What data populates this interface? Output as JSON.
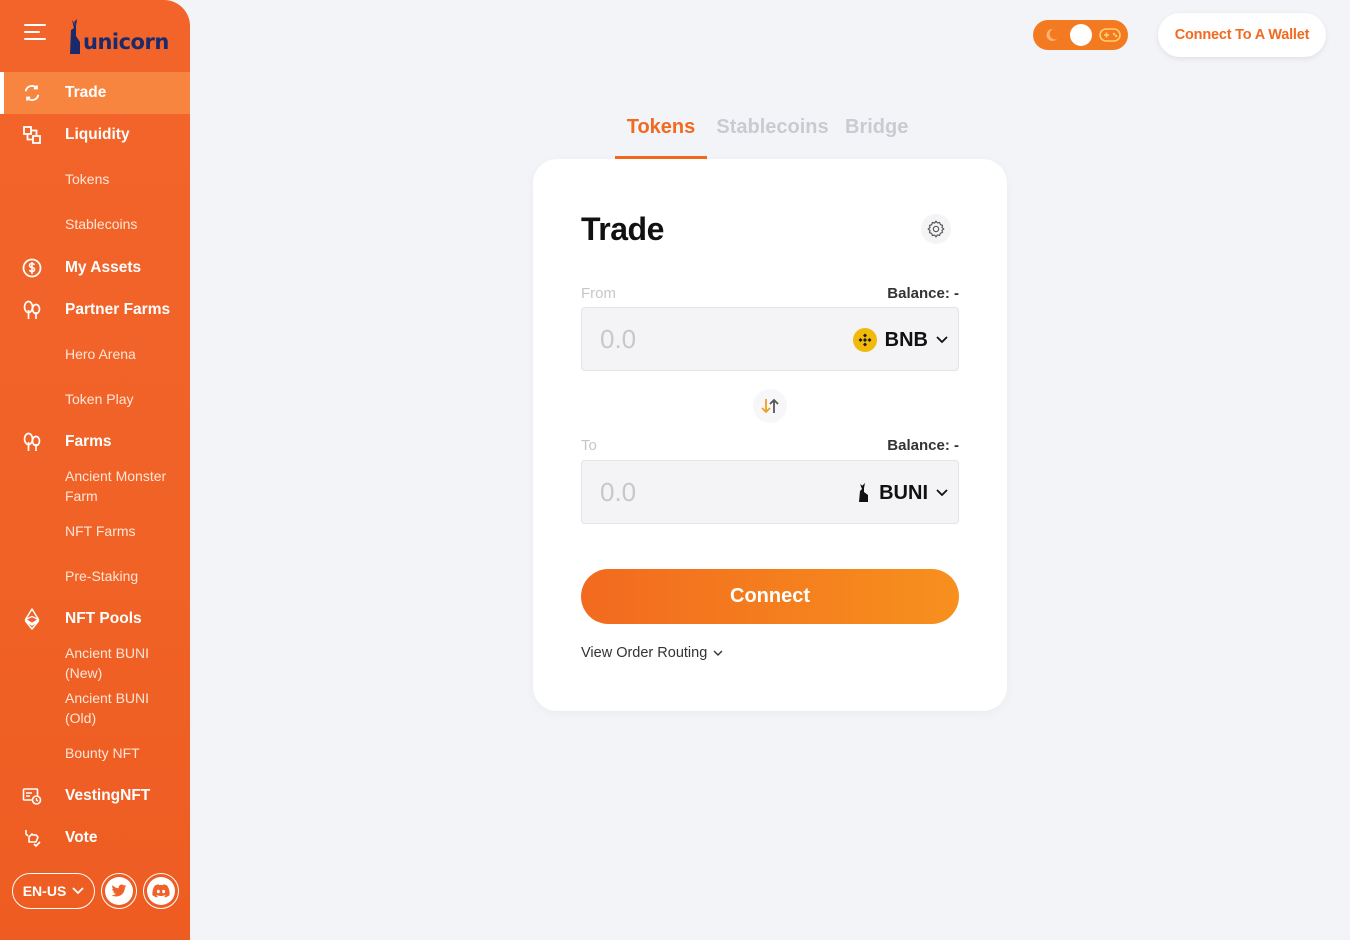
{
  "brand": {
    "name": "unicorn"
  },
  "sidebar": {
    "items": [
      {
        "label": "Trade",
        "type": "main",
        "icon": "swap-refresh-icon",
        "active": true
      },
      {
        "label": "Liquidity",
        "type": "main",
        "icon": "liquidity-icon"
      },
      {
        "label": "Tokens",
        "type": "sub"
      },
      {
        "label": "Stablecoins",
        "type": "sub"
      },
      {
        "label": "My Assets",
        "type": "main",
        "icon": "dollar-icon"
      },
      {
        "label": "Partner Farms",
        "type": "main",
        "icon": "trees-icon"
      },
      {
        "label": "Hero Arena",
        "type": "sub"
      },
      {
        "label": "Token Play",
        "type": "sub"
      },
      {
        "label": "Farms",
        "type": "main",
        "icon": "trees-icon"
      },
      {
        "label": "Ancient Monster Farm",
        "type": "sub"
      },
      {
        "label": "NFT Farms",
        "type": "sub"
      },
      {
        "label": "Pre-Staking",
        "type": "sub"
      },
      {
        "label": "NFT Pools",
        "type": "main",
        "icon": "ethereum-icon"
      },
      {
        "label": "Ancient BUNI (New)",
        "type": "sub"
      },
      {
        "label": "Ancient BUNI (Old)",
        "type": "sub"
      },
      {
        "label": "Bounty NFT",
        "type": "sub"
      },
      {
        "label": "VestingNFT",
        "type": "main",
        "icon": "vesting-icon"
      },
      {
        "label": "Vote",
        "type": "main",
        "icon": "vote-icon"
      }
    ],
    "footer": {
      "language": "EN-US",
      "social": [
        "twitter-icon",
        "discord-icon"
      ]
    }
  },
  "header": {
    "theme_toggle": {
      "state": "light",
      "icons": [
        "moon-icon",
        "gamepad-icon"
      ]
    },
    "connect_wallet_label": "Connect To A Wallet"
  },
  "tabs": [
    {
      "label": "Tokens",
      "active": true
    },
    {
      "label": "Stablecoins",
      "active": false
    },
    {
      "label": "Bridge",
      "active": false
    }
  ],
  "trade": {
    "title": "Trade",
    "from": {
      "label": "From",
      "balance": "Balance: -",
      "placeholder": "0.0",
      "token": "BNB"
    },
    "to": {
      "label": "To",
      "balance": "Balance: -",
      "placeholder": "0.0",
      "token": "BUNI"
    },
    "connect_label": "Connect",
    "routing_label": "View Order Routing"
  },
  "colors": {
    "accent": "#f26a1f",
    "sidebar": "#f0622a",
    "active_item": "#f7853f",
    "bnb": "#f0b90b",
    "brand_navy": "#1b2a6b"
  }
}
